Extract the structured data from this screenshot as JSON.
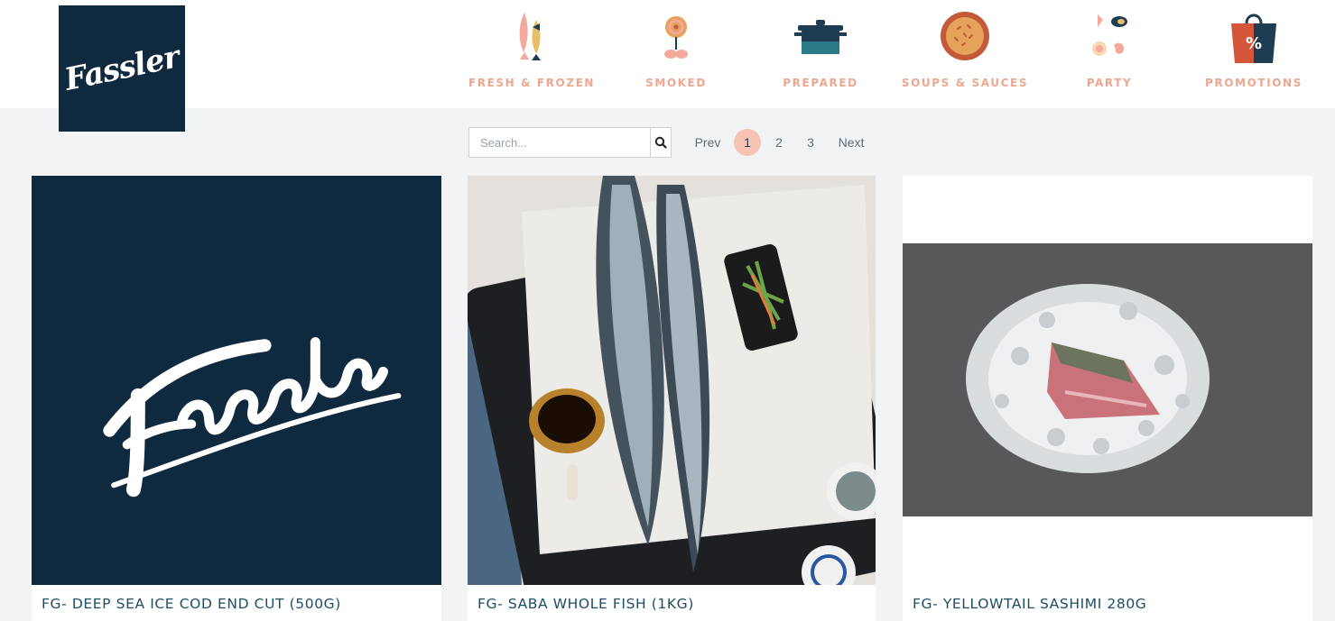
{
  "brand": {
    "name": "Fassler",
    "color": "#0f2a3e"
  },
  "nav": [
    {
      "label": "FRESH & FROZEN",
      "icon": "fish-icon"
    },
    {
      "label": "SMOKED",
      "icon": "smoked-salmon-icon"
    },
    {
      "label": "PREPARED",
      "icon": "pot-icon"
    },
    {
      "label": "SOUPS & SAUCES",
      "icon": "soup-bowl-icon"
    },
    {
      "label": "PARTY",
      "icon": "party-platter-icon"
    },
    {
      "label": "PROMOTIONS",
      "icon": "shopping-bag-percent-icon"
    }
  ],
  "search": {
    "placeholder": "Search...",
    "button_icon": "search-icon"
  },
  "pagination": {
    "prev": "Prev",
    "pages": [
      "1",
      "2",
      "3"
    ],
    "current": "1",
    "next": "Next"
  },
  "products": [
    {
      "title": "FG- DEEP SEA ICE COD END CUT (500G)",
      "image": "fassler-logo-placeholder"
    },
    {
      "title": "FG- SABA WHOLE FISH (1KG)",
      "image": "saba-fish-photo"
    },
    {
      "title": "FG- YELLOWTAIL SASHIMI 280G",
      "image": "yellowtail-on-ice-photo"
    }
  ],
  "colors": {
    "accent": "#eda791",
    "navy": "#0f2a3e",
    "title": "#1d4e63",
    "active_page": "#f6c3b4"
  }
}
